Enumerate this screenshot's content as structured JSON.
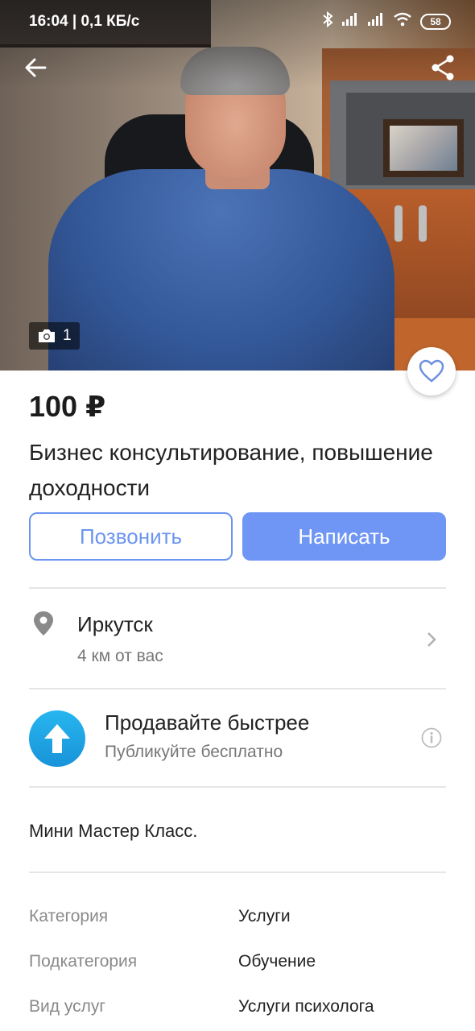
{
  "status_bar": {
    "time": "16:04 | 0,1 КБ/с",
    "battery": "58"
  },
  "gallery": {
    "photo_count": "1"
  },
  "listing": {
    "price": "100 ₽",
    "title": "Бизнес консультирование, повышение доходности"
  },
  "actions": {
    "call_label": "Позвонить",
    "write_label": "Написать"
  },
  "location": {
    "city": "Иркутск",
    "distance": "4 км от вас"
  },
  "promo": {
    "title": "Продавайте быстрее",
    "subtitle": "Публикуйте бесплатно"
  },
  "description": "Мини Мастер Класс.",
  "params": [
    {
      "label": "Категория",
      "value": "Услуги"
    },
    {
      "label": "Подкатегория",
      "value": "Обучение"
    },
    {
      "label": "Вид услуг",
      "value": "Услуги психолога"
    }
  ],
  "colors": {
    "accent": "#6f95f5",
    "promo": "#1f9fe0"
  },
  "icons": [
    "back-arrow-icon",
    "share-icon",
    "camera-icon",
    "heart-icon",
    "location-pin-icon",
    "chevron-right-icon",
    "arrow-up-icon",
    "info-icon"
  ]
}
